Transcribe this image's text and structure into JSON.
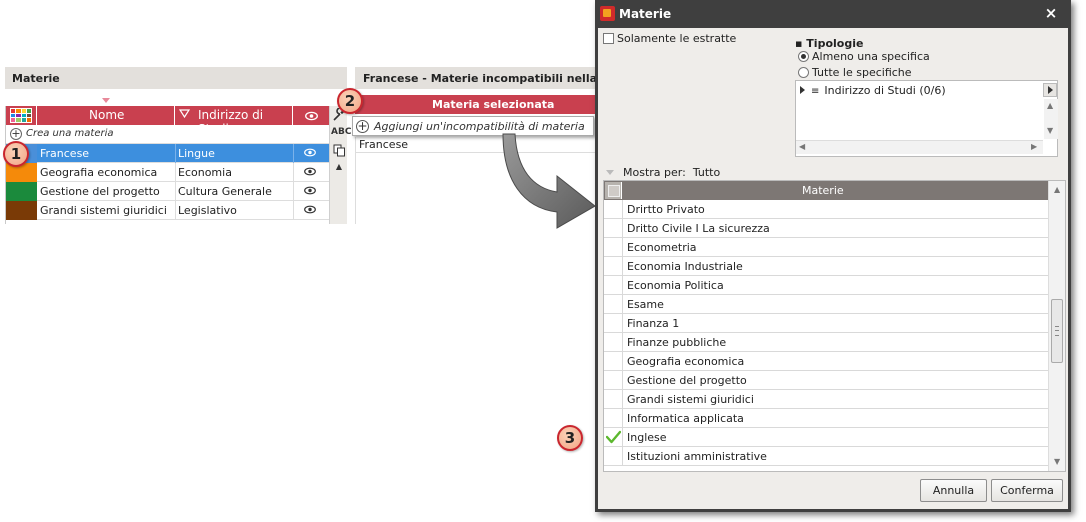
{
  "left_panel": {
    "title": "Materie",
    "columns": {
      "nome": "Nome",
      "indirizzo": "Indirizzo di Studi"
    },
    "palette_colors": [
      "#e53935",
      "#fb8c00",
      "#fdd835",
      "#43a047",
      "#1e88e5",
      "#8e24aa",
      "#00acc1",
      "#6d4c41",
      "#f06292",
      "#9ccc65",
      "#26a69a",
      "#ef6c00"
    ],
    "create_label": "Crea una materia",
    "rows": [
      {
        "nome": "Francese",
        "indirizzo": "Lingue",
        "color": "#4a8fd9",
        "selected": true
      },
      {
        "nome": "Geografia economica",
        "indirizzo": "Economia",
        "color": "#f58a0a",
        "selected": false
      },
      {
        "nome": "Gestione del progetto",
        "indirizzo": "Cultura Generale",
        "color": "#1b8a3c",
        "selected": false
      },
      {
        "nome": "Grandi sistemi giuridici",
        "indirizzo": "Legislativo",
        "color": "#7a3a06",
        "selected": false
      }
    ],
    "tools": {
      "abc": "ABC"
    }
  },
  "middle_panel": {
    "title": "Francese - Materie incompatibili nella stes",
    "column_header": "Materia selezionata",
    "add_label": "Aggiungi un'incompatibilità di materia",
    "rows": [
      "Francese"
    ]
  },
  "callouts": [
    "1",
    "2",
    "3"
  ],
  "dialog": {
    "title": "Materie",
    "close": "×",
    "only_extracted": "Solamente le estratte",
    "tipologie_title": "Tipologie",
    "radio_options": [
      {
        "label": "Almeno una specifica",
        "checked": true
      },
      {
        "label": "Tutte le specifiche",
        "checked": false
      }
    ],
    "tree_item": "Indirizzo di Studi (0/6)",
    "show_for": "Mostra per:",
    "show_for_value": "Tutto",
    "list_header": "Materie",
    "items": [
      {
        "label": "Drirtto Privato",
        "checked": false
      },
      {
        "label": "Dritto Civile I La sicurezza",
        "checked": false
      },
      {
        "label": "Econometria",
        "checked": false
      },
      {
        "label": "Economia Industriale",
        "checked": false
      },
      {
        "label": "Economia Politica",
        "checked": false
      },
      {
        "label": "Esame",
        "checked": false
      },
      {
        "label": "Finanza 1",
        "checked": false
      },
      {
        "label": "Finanze pubbliche",
        "checked": false
      },
      {
        "label": "Geografia economica",
        "checked": false
      },
      {
        "label": "Gestione del progetto",
        "checked": false
      },
      {
        "label": "Grandi sistemi giuridici",
        "checked": false
      },
      {
        "label": "Informatica applicata",
        "checked": false
      },
      {
        "label": "Inglese",
        "checked": true
      },
      {
        "label": "Istituzioni amministrative",
        "checked": false
      }
    ],
    "buttons": {
      "cancel": "Annulla",
      "confirm": "Conferma"
    }
  },
  "colors": {
    "header_red": "#c9404f",
    "selection_blue": "#3d8fde",
    "dialog_frame": "#3f3f3f",
    "list_header_gray": "#7d7774",
    "check_green": "#5cb82e"
  }
}
